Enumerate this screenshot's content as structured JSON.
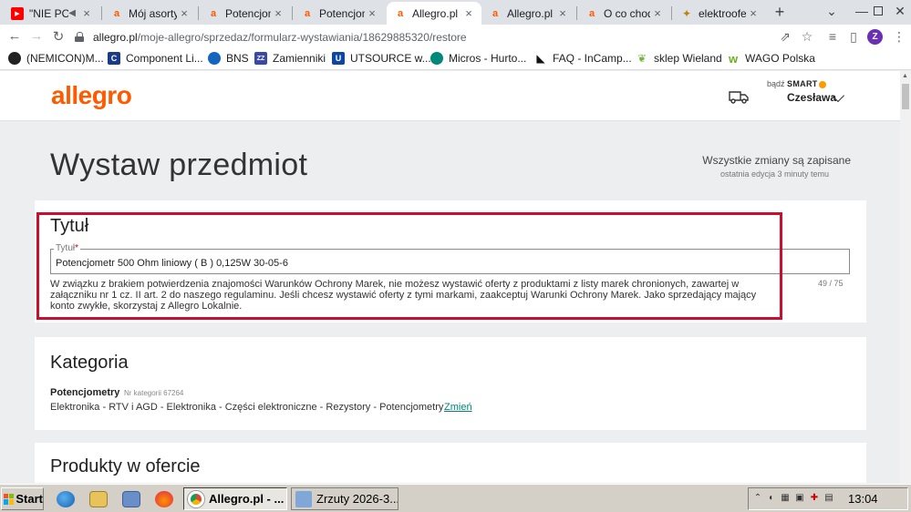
{
  "browser": {
    "tabs": [
      {
        "label": "\"NIE PO",
        "icon": "youtube-icon",
        "active": false
      },
      {
        "label": "Mój asortym",
        "icon": "allegro-icon",
        "active": false
      },
      {
        "label": "Potencjome",
        "icon": "allegro-icon",
        "active": false
      },
      {
        "label": "Potencjome",
        "icon": "allegro-icon",
        "active": false
      },
      {
        "label": "Allegro.pl -",
        "icon": "allegro-icon",
        "active": true
      },
      {
        "label": "Allegro.pl -",
        "icon": "allegro-icon",
        "active": false
      },
      {
        "label": "O co chodz",
        "icon": "allegro-icon",
        "active": false
      },
      {
        "label": "elektroofer",
        "icon": "bookmark-site-icon",
        "active": false
      }
    ],
    "tab_close": "×",
    "new_tab": "+",
    "url_host": "allegro.pl",
    "url_path": "/moje-allegro/sprzedaz/formularz-wystawiania/18629885320/restore",
    "profile_initial": "Z",
    "bookmarks": [
      {
        "label": "(NEMICON)M...",
        "color": "#222222"
      },
      {
        "label": "Component Li...",
        "color": "#1a3a8a"
      },
      {
        "label": "BNS",
        "color": "#1565c0"
      },
      {
        "label": "Zamienniki",
        "color": "#3949ab"
      },
      {
        "label": "UTSOURCE w...",
        "color": "#0d47a1"
      },
      {
        "label": "Micros - Hurto...",
        "color": "#00897b"
      },
      {
        "label": "FAQ - InCamp...",
        "color": "#111111"
      },
      {
        "label": "sklep Wieland",
        "color": "#7cb342"
      },
      {
        "label": "WAGO Polska",
        "color": "#6ab023"
      }
    ]
  },
  "header": {
    "logo": "allegro",
    "smart_prefix": "bądź",
    "smart_label": "SMART",
    "user_name": "Czesława"
  },
  "main": {
    "page_title": "Wystaw przedmiot",
    "saved_status": "Wszystkie zmiany są zapisane",
    "saved_sub": "ostatnia edycja 3 minuty temu"
  },
  "title_section": {
    "heading": "Tytuł",
    "field_label": "Tytuł",
    "required_mark": "*",
    "value": "Potencjometr 500 Ohm liniowy ( B ) 0,125W 30-05-6",
    "counter": "49  /  75",
    "warning": "W związku z brakiem potwierdzenia znajomości Warunków Ochrony Marek, nie możesz wystawić oferty z produktami z listy marek chronionych, zawartej w załączniku nr 1 cz. II art. 2 do naszego regulaminu. Jeśli chcesz wystawić oferty z tymi markami, zaakceptuj Warunki Ochrony Marek. Jako sprzedający mający konto zwykłe, skorzystaj z Allegro Lokalnie."
  },
  "category_section": {
    "heading": "Kategoria",
    "name": "Potencjometry",
    "number": "Nr kategorii 67264",
    "path": "Elektronika - RTV i AGD - Elektronika - Części elektroniczne - Rezystory - Potencjometry",
    "change_link": "Zmień"
  },
  "products_section": {
    "heading": "Produkty w ofercie"
  },
  "taskbar": {
    "start_label": "Start",
    "tasks": [
      {
        "label": "Allegro.pl - ...",
        "active": true
      },
      {
        "label": "Zrzuty 2026-3...",
        "active": false
      }
    ],
    "clock": "13:04"
  },
  "colors": {
    "accent": "#ff5a00",
    "highlight_frame": "#c8102e",
    "link": "#008673"
  }
}
